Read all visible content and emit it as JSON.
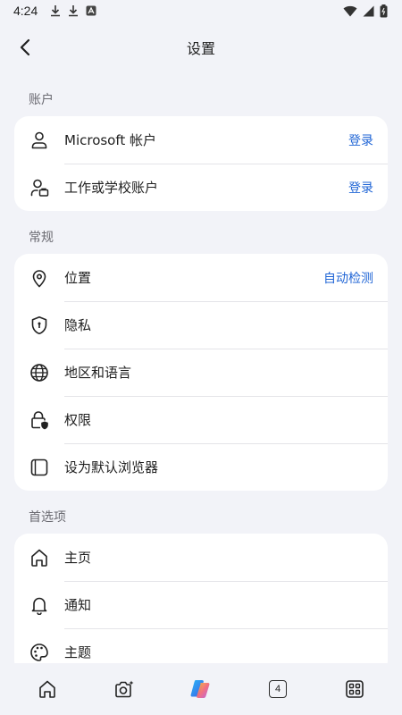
{
  "status_bar": {
    "time": "4:24"
  },
  "header": {
    "title": "设置",
    "back_icon": "back-arrow-icon"
  },
  "sections": [
    {
      "label": "账户",
      "items": [
        {
          "label": "Microsoft 帐户",
          "action": "登录",
          "icon": "person-icon"
        },
        {
          "label": "工作或学校账户",
          "action": "登录",
          "icon": "work-account-icon"
        }
      ]
    },
    {
      "label": "常规",
      "items": [
        {
          "label": "位置",
          "action": "自动检测",
          "icon": "location-pin-icon"
        },
        {
          "label": "隐私",
          "icon": "shield-icon"
        },
        {
          "label": "地区和语言",
          "icon": "globe-icon"
        },
        {
          "label": "权限",
          "icon": "lock-shield-icon"
        },
        {
          "label": "设为默认浏览器",
          "icon": "browser-window-icon"
        }
      ]
    },
    {
      "label": "首选项",
      "items": [
        {
          "label": "主页",
          "icon": "home-icon"
        },
        {
          "label": "通知",
          "icon": "bell-icon"
        },
        {
          "label": "主题",
          "icon": "palette-icon"
        }
      ]
    }
  ],
  "bottom_nav": {
    "tab_count": "4"
  },
  "colors": {
    "accent": "#2166d6",
    "background": "#f2f3f8",
    "card": "#ffffff"
  }
}
